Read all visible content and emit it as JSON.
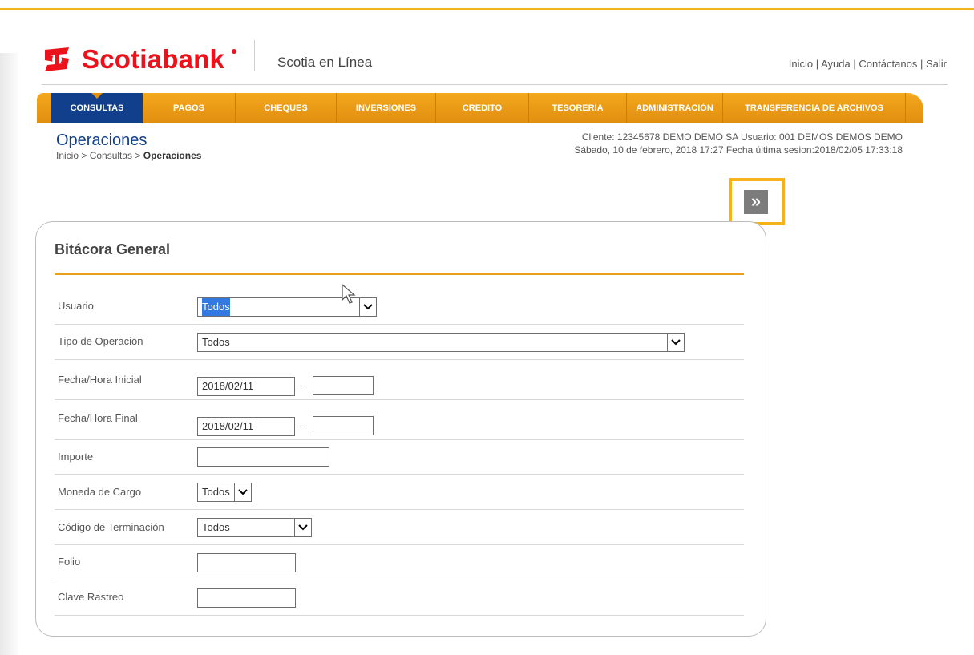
{
  "header": {
    "brand": "Scotiabank",
    "app_name": "Scotia en Línea",
    "links": [
      "Inicio",
      "Ayuda",
      "Contáctanos",
      "Salir"
    ],
    "link_separator": "|"
  },
  "nav": {
    "items": [
      {
        "label": "CONSULTAS",
        "active": true
      },
      {
        "label": "PAGOS"
      },
      {
        "label": "CHEQUES"
      },
      {
        "label": "INVERSIONES"
      },
      {
        "label": "CREDITO"
      },
      {
        "label": "TESORERIA"
      },
      {
        "label": "ADMINISTRACIÓN"
      },
      {
        "label": "TRANSFERENCIA DE ARCHIVOS"
      }
    ]
  },
  "page": {
    "title": "Operaciones",
    "breadcrumb_prefix": "Inicio > Consultas > ",
    "breadcrumb_current": "Operaciones",
    "client_line": "Cliente: 12345678 DEMO DEMO SA    Usuario: 001 DEMOS DEMOS DEMO",
    "date_line": "Sábado, 10 de febrero, 2018 17:27    Fecha última sesion:2018/02/05 17:33:18",
    "next_button": "»"
  },
  "form": {
    "title": "Bitácora General",
    "fields": {
      "usuario": {
        "label": "Usuario",
        "value": "Todos"
      },
      "tipo_operacion": {
        "label": "Tipo de Operación",
        "value": "Todos"
      },
      "fecha_inicial": {
        "label": "Fecha/Hora Inicial",
        "date": "2018/02/11",
        "time": ""
      },
      "fecha_final": {
        "label": "Fecha/Hora Final",
        "date": "2018/02/11",
        "time": ""
      },
      "importe": {
        "label": "Importe",
        "value": ""
      },
      "moneda": {
        "label": "Moneda de Cargo",
        "value": "Todos"
      },
      "codigo": {
        "label": "Código de Terminación",
        "value": "Todos"
      },
      "folio": {
        "label": "Folio",
        "value": ""
      },
      "clave": {
        "label": "Clave Rastreo",
        "value": ""
      }
    },
    "date_separator": "-"
  },
  "colors": {
    "brand_red": "#ec111a",
    "nav_orange": "#f4a81d",
    "nav_active_blue": "#113f8c",
    "highlight_frame": "#f5b21a",
    "selected_blue": "#3479e0"
  }
}
